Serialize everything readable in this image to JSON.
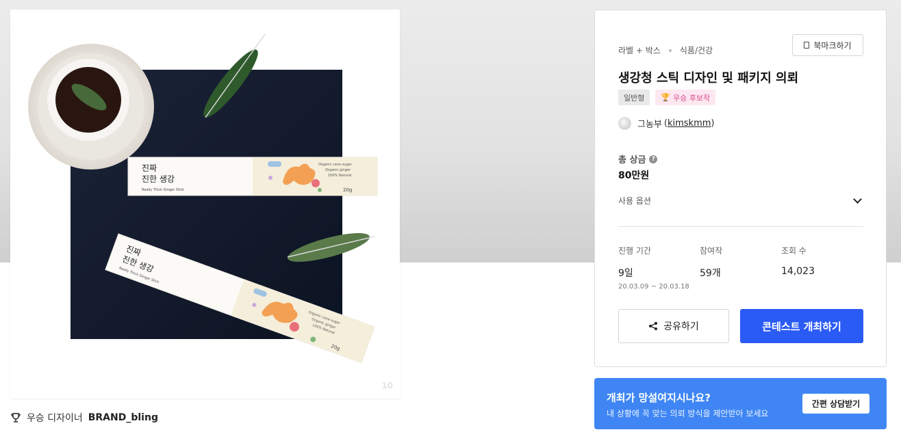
{
  "gallery": {
    "image_index": "10",
    "product_text": {
      "brand_line1": "진짜",
      "brand_line2": "진한 생강",
      "tagline": "Really Thick Ginger Stick",
      "info1": "Organic cane sugar",
      "info2": "Organic ginger",
      "info3": "100% Natural",
      "weight": "20g"
    },
    "winner_prefix": "우승 디자이너",
    "winner_name": "BRAND_bling"
  },
  "contest": {
    "category_primary": "라벨 + 박스",
    "category_secondary": "식품/건강",
    "bookmark_label": "북마크하기",
    "title": "생강청 스틱 디자인 및 패키지 의뢰",
    "badge_type": "일반형",
    "badge_winner": "우승 후보작",
    "host_name": "그농부",
    "host_id": "kimskmm",
    "prize_label": "총 상금",
    "prize_value": "80만원",
    "options_label": "사용 옵션",
    "stats": [
      {
        "label": "진행 기간",
        "value": "9일",
        "sub": "20.03.09 ~ 20.03.18"
      },
      {
        "label": "참여작",
        "value": "59개",
        "sub": ""
      },
      {
        "label": "조회 수",
        "value": "14,023",
        "sub": ""
      }
    ],
    "share_label": "공유하기",
    "host_button_label": "콘테스트 개최하기"
  },
  "consult": {
    "title": "개최가 망설여지시나요?",
    "subtitle": "내 상황에 꼭 맞는 의뢰 방식을 제안받아 보세요",
    "button_label": "간편 상담받기"
  },
  "colors": {
    "accent": "#2b5bf5",
    "banner": "#3f86f4",
    "winner_badge_text": "#d94a8c",
    "winner_badge_bg": "#fde8f1"
  }
}
